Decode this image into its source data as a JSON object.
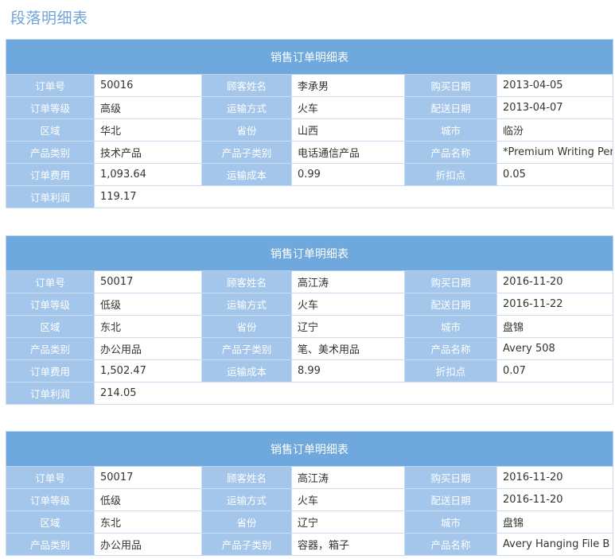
{
  "page": {
    "title": "段落明细表"
  },
  "colors": {
    "header_bg": "#6fa8dc",
    "label_bg": "#a3c6ea",
    "title": "#6fa3d8",
    "border": "#c8ddf2"
  },
  "tables": [
    {
      "caption": "销售订单明细表",
      "rows": [
        [
          {
            "label": "订单号",
            "value": "50016"
          },
          {
            "label": "顾客姓名",
            "value": "李承男"
          },
          {
            "label": "购买日期",
            "value": "2013-04-05"
          }
        ],
        [
          {
            "label": "订单等级",
            "value": "高级"
          },
          {
            "label": "运输方式",
            "value": "火车"
          },
          {
            "label": "配送日期",
            "value": "2013-04-07"
          }
        ],
        [
          {
            "label": "区域",
            "value": "华北"
          },
          {
            "label": "省份",
            "value": "山西"
          },
          {
            "label": "城市",
            "value": "临汾"
          }
        ],
        [
          {
            "label": "产品类别",
            "value": "技术产品"
          },
          {
            "label": "产品子类别",
            "value": "电话通信产品"
          },
          {
            "label": "产品名称",
            "value": "*Premium Writing Pen"
          }
        ],
        [
          {
            "label": "订单费用",
            "value": "1,093.64"
          },
          {
            "label": "运输成本",
            "value": "0.99"
          },
          {
            "label": "折扣点",
            "value": "0.05"
          }
        ]
      ],
      "profit": {
        "label": "订单利润",
        "value": "119.17"
      }
    },
    {
      "caption": "销售订单明细表",
      "rows": [
        [
          {
            "label": "订单号",
            "value": "50017"
          },
          {
            "label": "顾客姓名",
            "value": "高江涛"
          },
          {
            "label": "购买日期",
            "value": "2016-11-20"
          }
        ],
        [
          {
            "label": "订单等级",
            "value": "低级"
          },
          {
            "label": "运输方式",
            "value": "火车"
          },
          {
            "label": "配送日期",
            "value": "2016-11-22"
          }
        ],
        [
          {
            "label": "区域",
            "value": "东北"
          },
          {
            "label": "省份",
            "value": "辽宁"
          },
          {
            "label": "城市",
            "value": "盘锦"
          }
        ],
        [
          {
            "label": "产品类别",
            "value": "办公用品"
          },
          {
            "label": "产品子类别",
            "value": "笔、美术用品"
          },
          {
            "label": "产品名称",
            "value": "Avery 508"
          }
        ],
        [
          {
            "label": "订单费用",
            "value": "1,502.47"
          },
          {
            "label": "运输成本",
            "value": "8.99"
          },
          {
            "label": "折扣点",
            "value": "0.07"
          }
        ]
      ],
      "profit": {
        "label": "订单利润",
        "value": "214.05"
      }
    },
    {
      "caption": "销售订单明细表",
      "rows": [
        [
          {
            "label": "订单号",
            "value": "50017"
          },
          {
            "label": "顾客姓名",
            "value": "高江涛"
          },
          {
            "label": "购买日期",
            "value": "2016-11-20"
          }
        ],
        [
          {
            "label": "订单等级",
            "value": "低级"
          },
          {
            "label": "运输方式",
            "value": "火车"
          },
          {
            "label": "配送日期",
            "value": "2016-11-20"
          }
        ],
        [
          {
            "label": "区域",
            "value": "东北"
          },
          {
            "label": "省份",
            "value": "辽宁"
          },
          {
            "label": "城市",
            "value": "盘锦"
          }
        ],
        [
          {
            "label": "产品类别",
            "value": "办公用品"
          },
          {
            "label": "产品子类别",
            "value": "容器，箱子"
          },
          {
            "label": "产品名称",
            "value": "Avery Hanging File B"
          }
        ]
      ]
    }
  ]
}
